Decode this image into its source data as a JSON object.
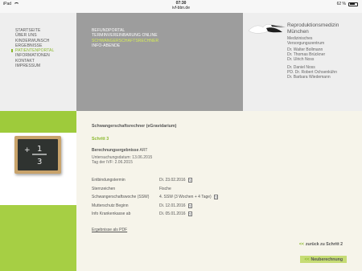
{
  "status_bar": {
    "device": "iPad",
    "time": "07:30",
    "url": "ivf-bbn.de",
    "battery": "62 %"
  },
  "nav_primary": [
    {
      "label": "STARTSEITE",
      "active": false
    },
    {
      "label": "ÜBER UNS",
      "active": false
    },
    {
      "label": "KINDERWUNSCH",
      "active": false
    },
    {
      "label": "ERGEBNISSE",
      "active": false
    },
    {
      "label": "PATIENTENPORTAL",
      "active": true
    },
    {
      "label": "INFORMATIONEN",
      "active": false
    },
    {
      "label": "KONTAKT",
      "active": false
    },
    {
      "label": "IMPRESSUM",
      "active": false
    }
  ],
  "nav_secondary": [
    {
      "label": "BEFUNDPORTAL",
      "active": false
    },
    {
      "label": "TERMINVEREINBARUNG ONLINE",
      "active": false
    },
    {
      "label": "SCHWANGERSCHAFTSRECHNER",
      "active": true
    },
    {
      "label": "INFO-ABENDE",
      "active": false
    }
  ],
  "brand": {
    "title_line1": "Reproduktionsmedizin",
    "title_line2": "München",
    "sub_line1": "Medizinisches",
    "sub_line2": "Versorgungszentrum",
    "doctors_group1": [
      "Dr. Walter Bollmann",
      "Dr. Thomas Brückner",
      "Dr. Ulrich Noss"
    ],
    "doctors_group2": [
      "Dr. Daniel Noss",
      "PD. Dr. Robert Ochsenkühn",
      "Dr. Barbara Wiedemann"
    ]
  },
  "chalkboard": {
    "numerator": "1",
    "denominator": "3",
    "operator": "+"
  },
  "content": {
    "title": "Schwangerschaftsrechner (eGravidarium)",
    "step": "Schritt 3",
    "result_bold": "Berechnungsergebnisse",
    "result_tag": "ART",
    "exam_date": "Untersuchungsdatum: 13.06.2015",
    "ivf_date": "Tag der IVF: 2.06.2015",
    "rows": [
      {
        "label": "Entbindungstermin",
        "value": "Di. 23.02.2016"
      },
      {
        "label": "Sternzeichen",
        "value": "Fische"
      },
      {
        "label": "Schwangerschaftswoche (SSW)",
        "value": "4. SSW (3 Wochen + 4 Tage)"
      },
      {
        "label": "Mutterschutz Beginn",
        "value": "Di. 12.01.2016"
      },
      {
        "label": "Info Krankenkasse ab",
        "value": "Di. 05.01.2016"
      }
    ],
    "hint_glyph": "?",
    "pdf_link": "Ergebnisse als PDF",
    "back_button": "zurück zu Schritt 2",
    "new_button": "Neuberechnung",
    "arrow_glyph": "<<"
  },
  "colors": {
    "accent_green": "#8ab82c",
    "nav_gray": "#9d9d9d",
    "highlight_yellow": "#d8ef54",
    "content_bg": "#f6f4ea"
  }
}
